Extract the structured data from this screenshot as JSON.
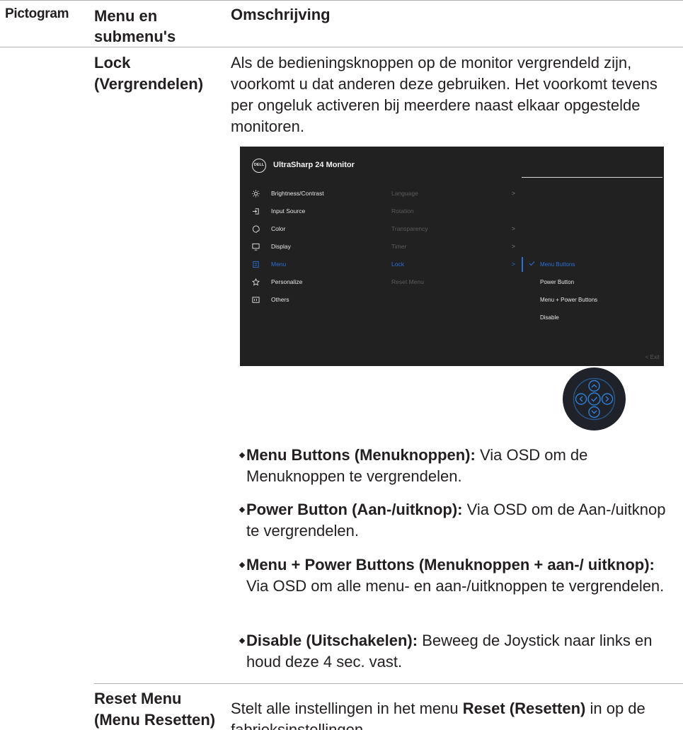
{
  "table": {
    "headers": {
      "pictogram": "Pictogram",
      "menu": "Menu en submenu's",
      "description": "Omschrijving"
    }
  },
  "lock": {
    "name": "Lock (Vergrendelen)",
    "description": "Als de bedieningsknoppen op de monitor vergrendeld zijn, voorkomt u dat anderen deze gebruiken. Het voorkomt tevens per ongeluk activeren bij meerdere naast elkaar opgestelde monitoren.",
    "bullets": [
      {
        "term": "Menu Buttons (Menuknoppen):",
        "text": " Via OSD om de Menuknoppen te vergrendelen."
      },
      {
        "term": "Power Button (Aan-/uitknop):",
        "text": " Via OSD om de Aan-/uitknop te vergrendelen."
      },
      {
        "term": "Menu + Power Buttons (Menuknoppen + aan-/ uitknop):",
        "text": " Via OSD om alle menu- en aan-/uitknoppen te vergrendelen."
      },
      {
        "term": "Disable (Uitschakelen):",
        "text": " Beweeg de Joystick naar links en houd deze 4 sec. vast."
      }
    ]
  },
  "osd": {
    "logo": "DELL",
    "title": "UltraSharp 24 Monitor",
    "menu": [
      {
        "label": "Brightness/Contrast",
        "icon": "sun-icon"
      },
      {
        "label": "Input Source",
        "icon": "input-icon"
      },
      {
        "label": "Color",
        "icon": "palette-icon"
      },
      {
        "label": "Display",
        "icon": "monitor-icon"
      },
      {
        "label": "Menu",
        "icon": "menu-icon",
        "active": true
      },
      {
        "label": "Personalize",
        "icon": "star-icon"
      },
      {
        "label": "Others",
        "icon": "others-icon"
      }
    ],
    "submenu": [
      {
        "label": "Language",
        "chevron": ">"
      },
      {
        "label": "Rotation",
        "chevron": ""
      },
      {
        "label": "Transparency",
        "chevron": ">"
      },
      {
        "label": "Timer",
        "chevron": ">"
      },
      {
        "label": "Lock",
        "chevron": ">",
        "active": true
      },
      {
        "label": "Reset Menu",
        "chevron": ""
      }
    ],
    "options": [
      {
        "label": "Menu Buttons",
        "checked": true
      },
      {
        "label": "Power Button"
      },
      {
        "label": "Menu + Power Buttons"
      },
      {
        "label": "Disable"
      }
    ],
    "exit": "<  Exit",
    "accent": "#2b6fd6"
  },
  "reset": {
    "name": "Reset Menu (Menu Resetten)",
    "pre": "Stelt alle instellingen in het menu ",
    "bold": "Reset (Resetten)",
    "post": " in op de fabrieksinstellingen."
  }
}
